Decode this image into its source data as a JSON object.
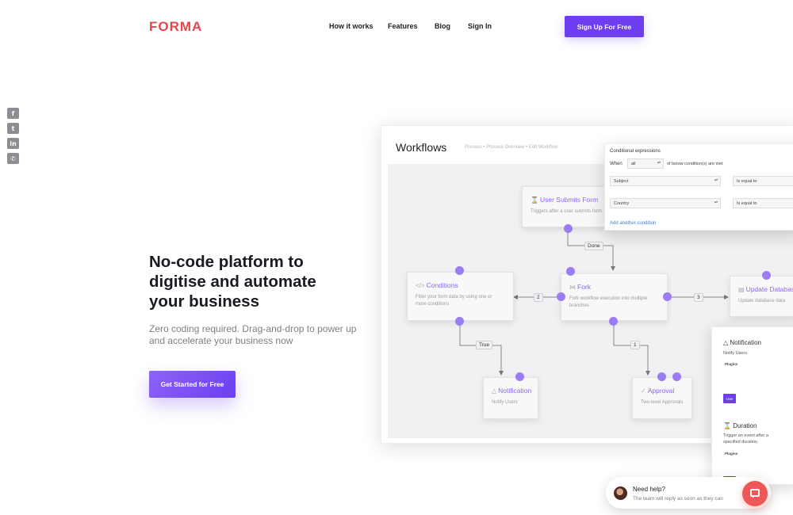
{
  "brand": {
    "logo": "FORMA",
    "color": "#e2474b"
  },
  "nav": {
    "items": [
      "How it works",
      "Features",
      "Blog",
      "Sign In"
    ],
    "cta": "Sign Up For Free"
  },
  "social": [
    "facebook-icon",
    "twitter-icon",
    "linkedin-icon",
    "whatsapp-icon"
  ],
  "hero": {
    "title": "No-code platform to digitise and automate your business",
    "subtitle": "Zero coding required. Drag-and-drop to power up and accelerate your business now",
    "cta": "Get Started for Free"
  },
  "workflow": {
    "title": "Workflows",
    "breadcrumb": "Process  •  Process Overview  •  Edit Workflow",
    "nodes": {
      "submit": {
        "title": "User Submits Form",
        "desc": "Triggers after a user submits form"
      },
      "conditions": {
        "title": "Conditions",
        "desc": "Filter your form data by using one or more conditions"
      },
      "fork": {
        "title": "Fork",
        "desc": "Fork workflow execution into multiple branches"
      },
      "update": {
        "title": "Update Database",
        "desc": "Update database data"
      },
      "notification": {
        "title": "Notification",
        "desc": "Notify Users"
      },
      "approval": {
        "title": "Approval",
        "desc": "Two-level Approvals"
      }
    },
    "edges": {
      "done": "Done",
      "two": "2",
      "three": "3",
      "true": "True",
      "one": "1"
    }
  },
  "conditional": {
    "title": "Conditional expressions",
    "when_label": "When",
    "when_value": "all",
    "when_suffix": "of below condition(s) are met",
    "rows": [
      {
        "field": "Subject",
        "op": "Is equal to"
      },
      {
        "field": "Country",
        "op": "Is equal to"
      }
    ],
    "add": "Add another condition"
  },
  "panel": {
    "notification": {
      "title": "Notification",
      "desc": "Notify Users",
      "tag": "Plugins",
      "use": "Use"
    },
    "duration": {
      "title": "Duration",
      "desc": "Trigger an event after a specified duration",
      "tag": "Plugins"
    }
  },
  "chat": {
    "title": "Need help?",
    "subtitle": "The team will reply as soon as they can"
  },
  "colors": {
    "accent": "#6d3ff0",
    "node_title": "#8c67f0",
    "chat": "#ee5755"
  }
}
